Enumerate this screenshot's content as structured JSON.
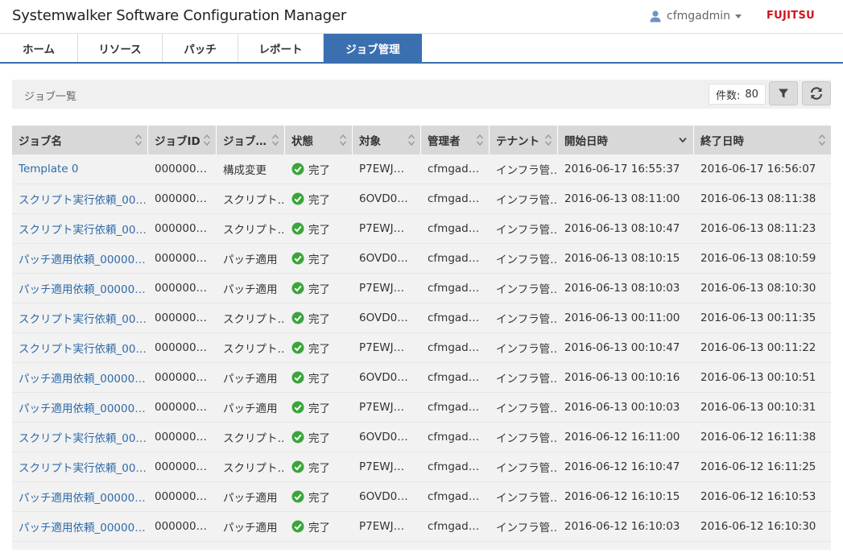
{
  "app": {
    "title": "Systemwalker Software Configuration Manager",
    "user": "cfmgadmin",
    "logo": "FUJITSU",
    "user_icon": "person-icon"
  },
  "tabs": [
    {
      "label": "ホーム",
      "active": false
    },
    {
      "label": "リソース",
      "active": false
    },
    {
      "label": "パッチ",
      "active": false
    },
    {
      "label": "レポート",
      "active": false
    },
    {
      "label": "ジョブ管理",
      "active": true
    }
  ],
  "list": {
    "title": "ジョブ一覧",
    "count_label": "件数:",
    "count_value": "80",
    "filter_icon": "filter-icon",
    "refresh_icon": "refresh-icon"
  },
  "table": {
    "columns": [
      {
        "label": "ジョブ名",
        "sort": "both"
      },
      {
        "label": "ジョブID",
        "sort": "both"
      },
      {
        "label": "ジョブ…",
        "sort": "both"
      },
      {
        "label": "状態",
        "sort": "both"
      },
      {
        "label": "対象",
        "sort": "both"
      },
      {
        "label": "管理者",
        "sort": "both"
      },
      {
        "label": "テナント",
        "sort": "both"
      },
      {
        "label": "開始日時",
        "sort": "desc"
      },
      {
        "label": "終了日時",
        "sort": "both"
      }
    ],
    "rows": [
      [
        "Template 0",
        "000000…",
        "構成変更",
        "完了",
        "P7EWJ…",
        "cfmgad…",
        "インフラ管…",
        "2016-06-17 16:55:37",
        "2016-06-17 16:56:07"
      ],
      [
        "スクリプト実行依頼_00…",
        "000000…",
        "スクリプト…",
        "完了",
        "6OVD0…",
        "cfmgad…",
        "インフラ管…",
        "2016-06-13 08:11:00",
        "2016-06-13 08:11:38"
      ],
      [
        "スクリプト実行依頼_00…",
        "000000…",
        "スクリプト…",
        "完了",
        "P7EWJ…",
        "cfmgad…",
        "インフラ管…",
        "2016-06-13 08:10:47",
        "2016-06-13 08:11:23"
      ],
      [
        "パッチ適用依頼_00000…",
        "000000…",
        "パッチ適用",
        "完了",
        "6OVD0…",
        "cfmgad…",
        "インフラ管…",
        "2016-06-13 08:10:15",
        "2016-06-13 08:10:59"
      ],
      [
        "パッチ適用依頼_00000…",
        "000000…",
        "パッチ適用",
        "完了",
        "P7EWJ…",
        "cfmgad…",
        "インフラ管…",
        "2016-06-13 08:10:03",
        "2016-06-13 08:10:30"
      ],
      [
        "スクリプト実行依頼_00…",
        "000000…",
        "スクリプト…",
        "完了",
        "6OVD0…",
        "cfmgad…",
        "インフラ管…",
        "2016-06-13 00:11:00",
        "2016-06-13 00:11:35"
      ],
      [
        "スクリプト実行依頼_00…",
        "000000…",
        "スクリプト…",
        "完了",
        "P7EWJ…",
        "cfmgad…",
        "インフラ管…",
        "2016-06-13 00:10:47",
        "2016-06-13 00:11:22"
      ],
      [
        "パッチ適用依頼_00000…",
        "000000…",
        "パッチ適用",
        "完了",
        "6OVD0…",
        "cfmgad…",
        "インフラ管…",
        "2016-06-13 00:10:16",
        "2016-06-13 00:10:51"
      ],
      [
        "パッチ適用依頼_00000…",
        "000000…",
        "パッチ適用",
        "完了",
        "P7EWJ…",
        "cfmgad…",
        "インフラ管…",
        "2016-06-13 00:10:03",
        "2016-06-13 00:10:31"
      ],
      [
        "スクリプト実行依頼_00…",
        "000000…",
        "スクリプト…",
        "完了",
        "6OVD0…",
        "cfmgad…",
        "インフラ管…",
        "2016-06-12 16:11:00",
        "2016-06-12 16:11:38"
      ],
      [
        "スクリプト実行依頼_00…",
        "000000…",
        "スクリプト…",
        "完了",
        "P7EWJ…",
        "cfmgad…",
        "インフラ管…",
        "2016-06-12 16:10:47",
        "2016-06-12 16:11:25"
      ],
      [
        "パッチ適用依頼_00000…",
        "000000…",
        "パッチ適用",
        "完了",
        "6OVD0…",
        "cfmgad…",
        "インフラ管…",
        "2016-06-12 16:10:15",
        "2016-06-12 16:10:53"
      ],
      [
        "パッチ適用依頼_00000…",
        "000000…",
        "パッチ適用",
        "完了",
        "P7EWJ…",
        "cfmgad…",
        "インフラ管…",
        "2016-06-12 16:10:03",
        "2016-06-12 16:10:30"
      ]
    ],
    "status_icon": "check-circle-icon",
    "status_color": "#3aa53a",
    "link_color": "#2f6aa8"
  },
  "colors": {
    "accent": "#3a6fb0",
    "brand": "#d3141c"
  }
}
